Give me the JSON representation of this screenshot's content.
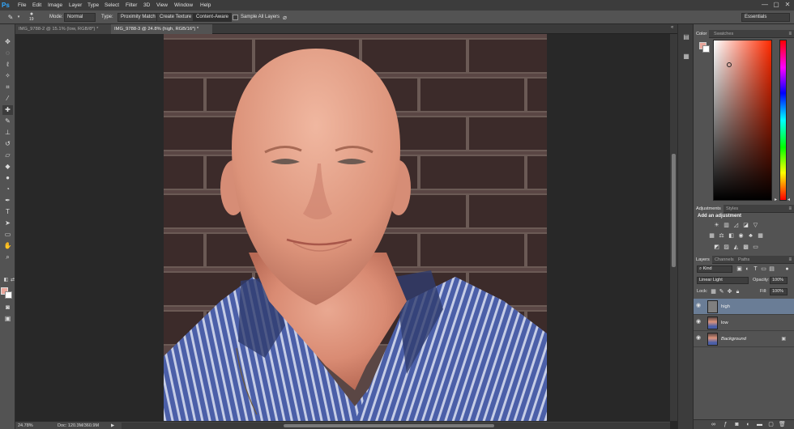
{
  "app": {
    "logo": "Ps"
  },
  "menu": [
    "File",
    "Edit",
    "Image",
    "Layer",
    "Type",
    "Select",
    "Filter",
    "3D",
    "View",
    "Window",
    "Help"
  ],
  "window_controls": [
    "—",
    "▢",
    "✕"
  ],
  "options_bar": {
    "brush_size": "19",
    "mode_label": "Mode:",
    "mode_value": "Normal",
    "type_label": "Type:",
    "proximity_match": "Proximity Match",
    "create_texture": "Create Texture",
    "content_aware": "Content-Aware",
    "sample_all_layers": "Sample All Layers",
    "workspace": "Essentials"
  },
  "doc_tabs": [
    {
      "label": "IMG_9788-2 @ 15.1% (low, RGB/8*) *",
      "active": false
    },
    {
      "label": "IMG_9788-3 @ 24.8% (high, RGB/16*) *",
      "active": true
    }
  ],
  "status": {
    "zoom": "24.78%",
    "doc": "Doc: 120.3M/360.9M"
  },
  "color_panel": {
    "tabs": [
      "Color",
      "Swatches"
    ],
    "foreground": "#e8a59a",
    "background": "#ffffff"
  },
  "adjustments_panel": {
    "tabs": [
      "Adjustments",
      "Styles"
    ],
    "title": "Add an adjustment"
  },
  "layers_panel": {
    "tabs": [
      "Layers",
      "Channels",
      "Paths"
    ],
    "filter_kind": "Kind",
    "blend_mode": "Linear Light",
    "opacity_label": "Opacity:",
    "opacity_value": "100%",
    "lock_label": "Lock:",
    "fill_label": "Fill:",
    "fill_value": "100%",
    "layers": [
      {
        "name": "high",
        "selected": true,
        "italic": false
      },
      {
        "name": "low",
        "selected": false,
        "italic": false
      },
      {
        "name": "Background",
        "selected": false,
        "italic": true
      }
    ]
  },
  "colors": {
    "accent": "#31a8ff",
    "selection": "#6a7d96",
    "panel": "#535353",
    "menu": "#3c3c3c"
  }
}
